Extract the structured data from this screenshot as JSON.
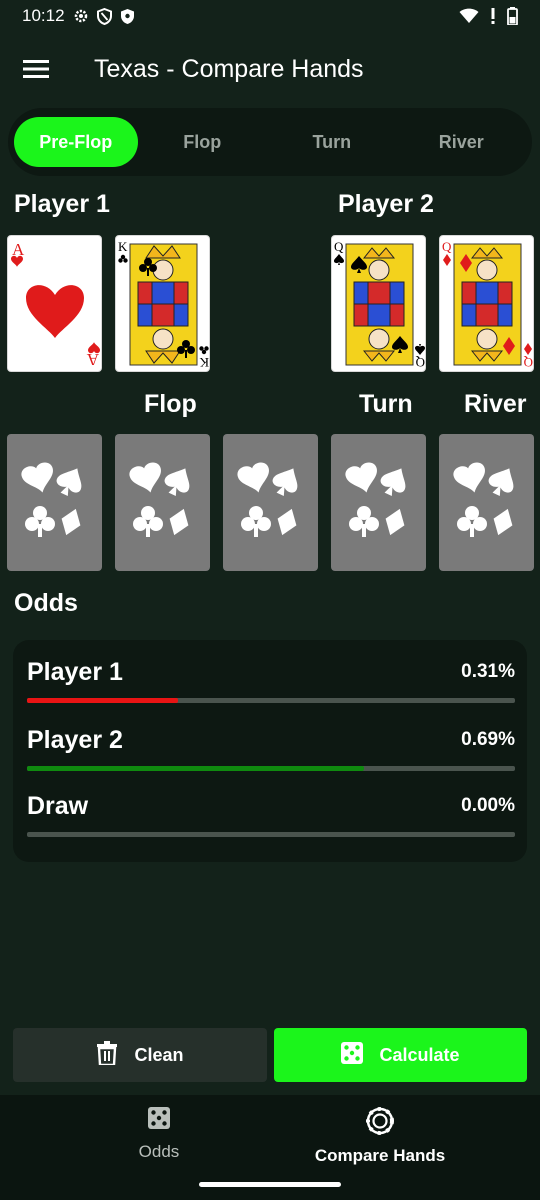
{
  "status_bar": {
    "time": "10:12",
    "icons_left": [
      "gear-icon",
      "shield-icon",
      "shield-filled-icon"
    ],
    "icons_right": [
      "wifi-icon",
      "battery-alert-icon",
      "battery-icon"
    ]
  },
  "app_bar": {
    "title": "Texas - Compare Hands",
    "menu_icon": "hamburger-menu-icon"
  },
  "tabs": [
    {
      "label": "Pre-Flop",
      "active": true
    },
    {
      "label": "Flop",
      "active": false
    },
    {
      "label": "Turn",
      "active": false
    },
    {
      "label": "River",
      "active": false
    }
  ],
  "players": [
    {
      "label": "Player 1",
      "cards": [
        {
          "rank": "A",
          "suit": "hearts"
        },
        {
          "rank": "K",
          "suit": "clubs"
        }
      ]
    },
    {
      "label": "Player 2",
      "cards": [
        {
          "rank": "Q",
          "suit": "spades"
        },
        {
          "rank": "Q",
          "suit": "diamonds"
        }
      ]
    }
  ],
  "board": {
    "flop_label": "Flop",
    "turn_label": "Turn",
    "river_label": "River",
    "placeholder_icon": "card-suits-icon"
  },
  "odds": {
    "title": "Odds",
    "rows": [
      {
        "name": "Player 1",
        "value": "0.31%",
        "fraction": 0.31,
        "color": "#e81414"
      },
      {
        "name": "Player 2",
        "value": "0.69%",
        "fraction": 0.69,
        "color": "#0f8a0f"
      },
      {
        "name": "Draw",
        "value": "0.00%",
        "fraction": 0.0,
        "color": "#0f8a0f"
      }
    ]
  },
  "actions": {
    "clean_label": "Clean",
    "clean_icon": "trash-icon",
    "calculate_label": "Calculate",
    "calculate_icon": "dice-icon"
  },
  "bottom_nav": [
    {
      "label": "Odds",
      "icon": "dice-icon",
      "active": false
    },
    {
      "label": "Compare Hands",
      "icon": "poker-chip-icon",
      "active": true
    }
  ],
  "colors": {
    "background": "#13221a",
    "panel": "#0d1812",
    "accent": "#1bf51b",
    "player1": "#e81414",
    "player2": "#0f8a0f"
  }
}
